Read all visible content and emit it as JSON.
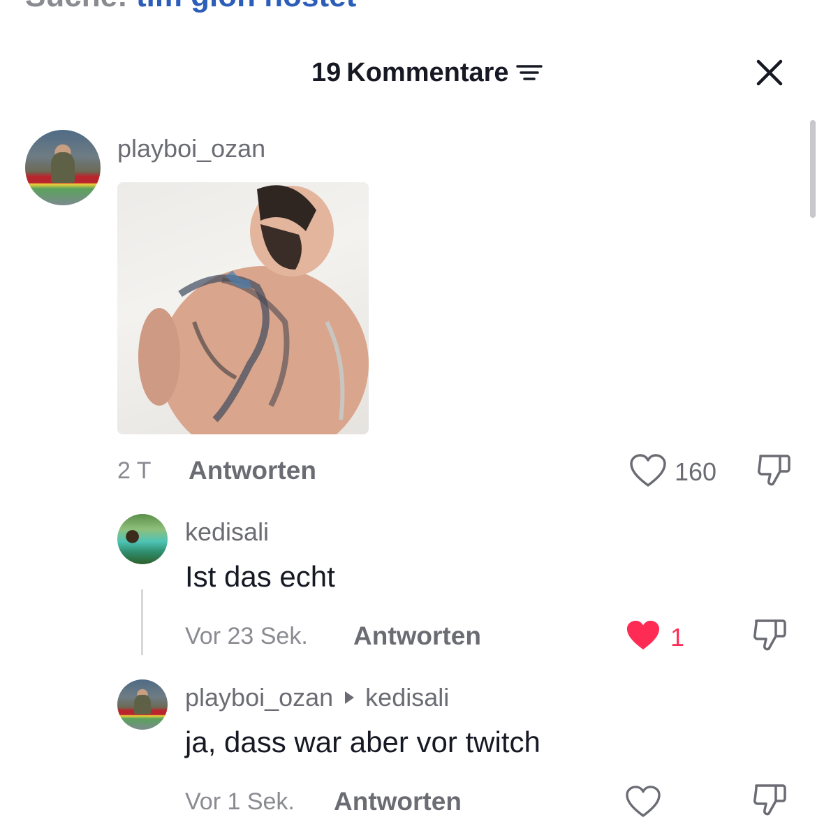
{
  "top_search": {
    "prefix": "Suche:",
    "query": "tim gion ñostet"
  },
  "header": {
    "comment_count": "19",
    "title_suffix": "Kommentare"
  },
  "icons": {
    "filter": "filter-icon",
    "close": "close-icon",
    "heart_outline": "heart-outline-icon",
    "heart_filled": "heart-filled-icon",
    "dislike": "thumbs-down-icon",
    "reply_arrow": "reply-to-arrow-icon"
  },
  "colors": {
    "like_active": "#fe2c55",
    "link_blue": "#2b5db9",
    "text_gray": "#8a8b91"
  },
  "comments": [
    {
      "username": "playboi_ozan",
      "has_photo": true,
      "time": "2 T",
      "reply_label": "Antworten",
      "likes": "160",
      "liked": false
    },
    {
      "username": "kedisali",
      "text": "Ist das echt",
      "time": "Vor 23 Sek.",
      "reply_label": "Antworten",
      "likes": "1",
      "liked": true
    },
    {
      "username": "playboi_ozan",
      "reply_to": "kedisali",
      "text": "ja, dass war aber vor twitch",
      "time": "Vor 1 Sek.",
      "reply_label": "Antworten",
      "likes": "",
      "liked": false
    }
  ]
}
